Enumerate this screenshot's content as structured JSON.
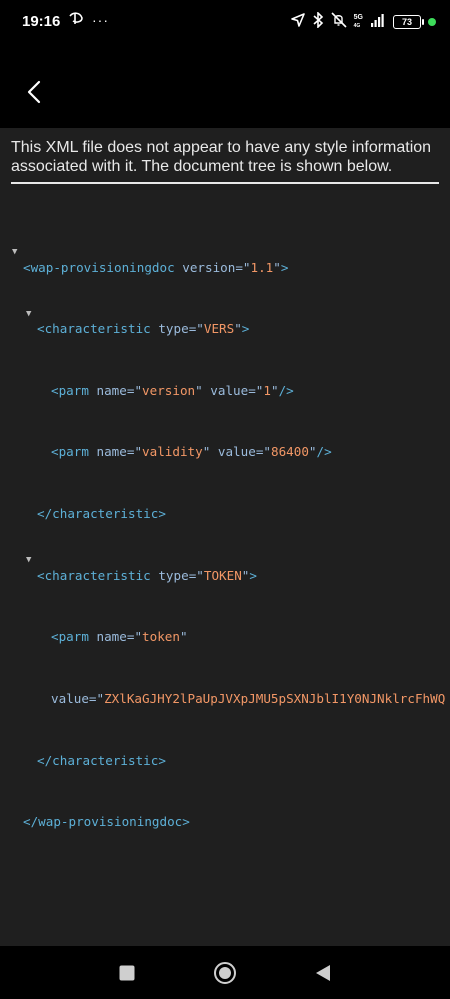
{
  "status_bar": {
    "time": "19:16",
    "more": "···",
    "network_top": "5G",
    "network_bottom": "4G",
    "battery": "73"
  },
  "toolbar": {
    "back_icon": "chevron-left-icon"
  },
  "page": {
    "info_text": "This XML file does not appear to have any style information associated with it. The document tree is shown below."
  },
  "xml": {
    "root_tag": "wap-provisioningdoc",
    "root_attr_name": "version",
    "root_attr_value": "1.1",
    "char1_tag": "characteristic",
    "char1_attr_name": "type",
    "char1_attr_value": "VERS",
    "parm1_name_attr": "name",
    "parm1_name": "version",
    "parm1_value_attr": "value",
    "parm1_value": "1",
    "parm2_name_attr": "name",
    "parm2_name": "validity",
    "parm2_value_attr": "value",
    "parm2_value": "86400",
    "char1_close": "characteristic",
    "char2_tag": "characteristic",
    "char2_attr_name": "type",
    "char2_attr_value": "TOKEN",
    "parm3_name_attr": "name",
    "parm3_name": "token",
    "parm3_value_attr": "value",
    "parm3_value": "ZXlKaGJHY2lPaUpJVXpJMU5pSXNJblI1Y0NJNklrcFhWQ",
    "char2_close": "characteristic",
    "root_close": "wap-provisioningdoc"
  },
  "nav": {
    "recents_icon": "square-icon",
    "home_icon": "circle-home-icon",
    "back_icon": "triangle-back-icon"
  }
}
